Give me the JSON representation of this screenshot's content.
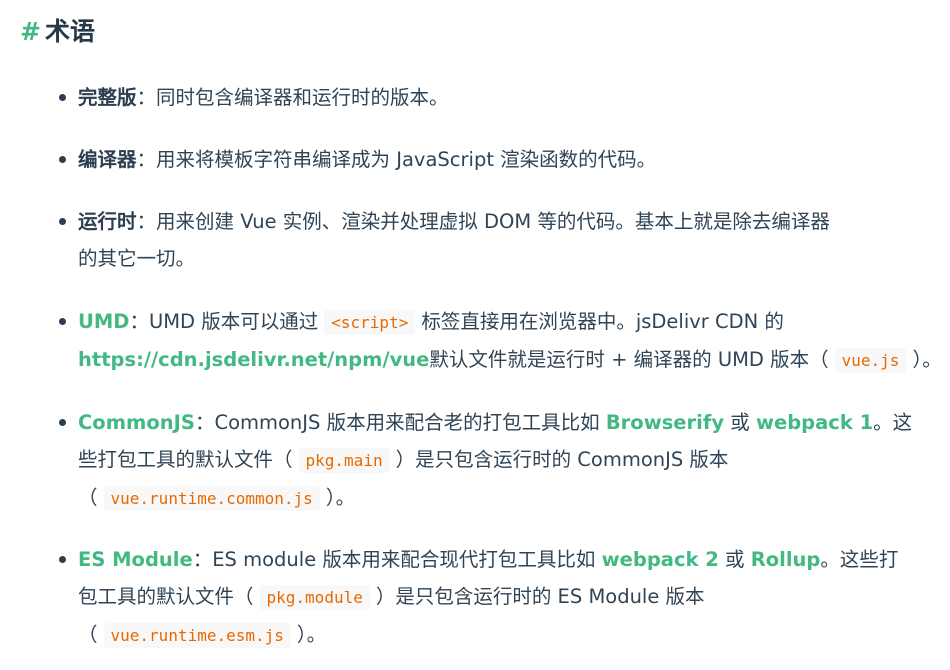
{
  "heading": {
    "hash": "#",
    "title": "术语"
  },
  "items": [
    {
      "term": "完整版",
      "sep": "：",
      "text": "同时包含编译器和运行时的版本。"
    },
    {
      "term": "编译器",
      "sep": "：",
      "text": "用来将模板字符串编译成为 JavaScript 渲染函数的代码。"
    },
    {
      "term": "运行时",
      "sep": "：",
      "line1": "用来创建 Vue 实例、渲染并处理虚拟 DOM 等的代码。基本上就是除去编译器",
      "line2": "的其它一切。"
    },
    {
      "term": "UMD",
      "sep": "：",
      "t1": "UMD 版本可以通过",
      "code1": "<script>",
      "t2": "标签直接用在浏览器中。jsDelivr CDN 的",
      "link1": "https://cdn.jsdelivr.net/npm/vue",
      "t3": "默认文件就是运行时 + 编译器的 UMD 版本（",
      "code2": "vue.js",
      "t4": "）。"
    },
    {
      "term": "CommonJS",
      "sep": "：",
      "t1": "CommonJS 版本用来配合老的打包工具比如",
      "link1": "Browserify",
      "t2": "或",
      "link2": "webpack 1",
      "t3": "。这",
      "t4": "些打包工具的默认文件（",
      "code1": "pkg.main",
      "t5": "）是只包含运行时的 CommonJS 版本",
      "t6": "（",
      "code2": "vue.runtime.common.js",
      "t7": "）。"
    },
    {
      "term": "ES Module",
      "sep": "：",
      "t1": "ES module 版本用来配合现代打包工具比如",
      "link1": "webpack 2",
      "t2": "或",
      "link2": "Rollup",
      "t3": "。这些打",
      "t4": "包工具的默认文件（",
      "code1": "pkg.module",
      "t5": "）是只包含运行时的 ES Module 版本",
      "t6": "（",
      "code2": "vue.runtime.esm.js",
      "t7": "）。"
    }
  ],
  "colors": {
    "accent": "#42b983",
    "code": "#e96900",
    "text": "#304455",
    "heading": "#273849"
  }
}
